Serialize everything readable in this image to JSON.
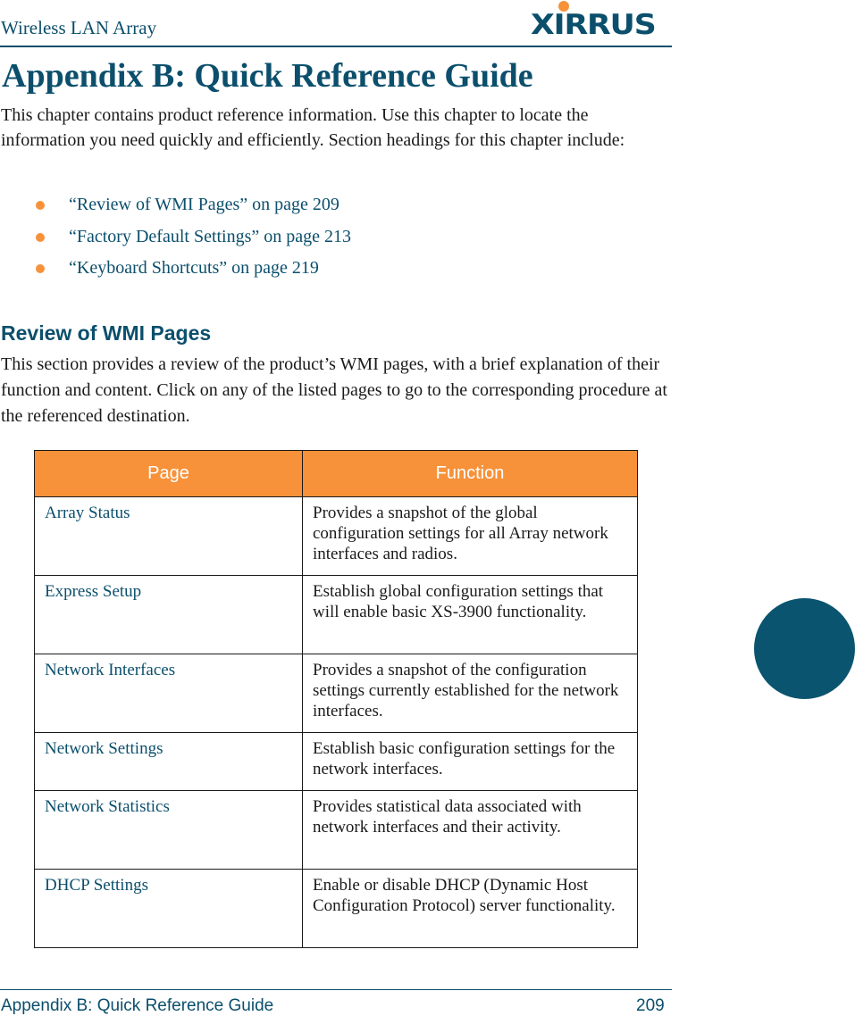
{
  "header": {
    "title": "Wireless LAN Array",
    "logo_text": "XIRRUS",
    "brand_color": "#0b4f6c",
    "accent_color": "#f7923a"
  },
  "page": {
    "title": "Appendix B: Quick Reference Guide",
    "intro": "This chapter contains product reference information. Use this chapter to locate the information you need quickly and efficiently. Section headings for this chapter include:",
    "links": [
      {
        "label": "“Review of WMI Pages” on page 209"
      },
      {
        "label": "“Factory Default Settings” on page 213"
      },
      {
        "label": "“Keyboard Shortcuts” on page 219"
      }
    ]
  },
  "section": {
    "heading": "Review of WMI Pages",
    "body": "This section provides a review of the product’s WMI pages, with a brief explanation of their function and content. Click on any of the listed pages to go to the corresponding procedure at the referenced destination."
  },
  "table": {
    "headers": [
      "Page",
      "Function"
    ],
    "rows": [
      {
        "page": "Array Status",
        "function": "Provides a snapshot of the global configuration settings for all Array network interfaces and radios."
      },
      {
        "page": "Express Setup",
        "function": "Establish global configuration settings that will enable basic XS-3900 functionality."
      },
      {
        "page": "Network Interfaces",
        "function": "Provides a snapshot of the configuration settings currently established for the network interfaces."
      },
      {
        "page": "Network Settings",
        "function": "Establish basic configuration settings for the network interfaces."
      },
      {
        "page": "Network Statistics",
        "function": "Provides statistical data associated with network interfaces and their activity."
      },
      {
        "page": "DHCP Settings",
        "function": "Enable or disable DHCP (Dynamic Host Configuration Protocol) server functionality."
      }
    ]
  },
  "footer": {
    "chapter": "Appendix B: Quick Reference Guide",
    "page_number": "209"
  }
}
